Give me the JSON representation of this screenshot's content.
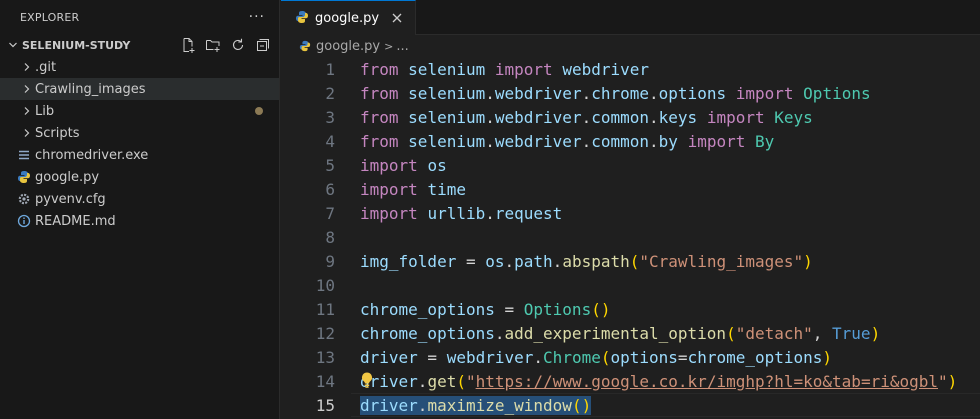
{
  "sidebar": {
    "title": "EXPLORER",
    "more": "···",
    "workspace": "SELENIUM-STUDY",
    "actions": [
      "new-file-icon",
      "new-folder-icon",
      "refresh-icon",
      "collapse-all-icon"
    ],
    "items": [
      {
        "label": ".git",
        "kind": "folder"
      },
      {
        "label": "Crawling_images",
        "kind": "folder"
      },
      {
        "label": "Lib",
        "kind": "folder",
        "modified": true
      },
      {
        "label": "Scripts",
        "kind": "folder"
      },
      {
        "label": "chromedriver.exe",
        "kind": "file",
        "icon": "exe-icon"
      },
      {
        "label": "google.py",
        "kind": "file",
        "icon": "python-icon"
      },
      {
        "label": "pyvenv.cfg",
        "kind": "file",
        "icon": "settings-icon"
      },
      {
        "label": "README.md",
        "kind": "file",
        "icon": "info-icon"
      }
    ]
  },
  "editor": {
    "tab_label": "google.py",
    "breadcrumb": {
      "file": "google.py",
      "sep": ">",
      "rest": "..."
    },
    "current_line": 15,
    "colors": {
      "keyword": "#c586c0",
      "function": "#dcdcaa",
      "variable": "#9cdcfe",
      "class": "#4ec9b0",
      "string": "#ce9178",
      "constant": "#569cd6",
      "selection": "#264f78"
    },
    "lines": [
      {
        "n": "1",
        "t": [
          [
            "kw",
            "from"
          ],
          [
            "op",
            " "
          ],
          [
            "var",
            "selenium"
          ],
          [
            "op",
            " "
          ],
          [
            "kw",
            "import"
          ],
          [
            "op",
            " "
          ],
          [
            "var",
            "webdriver"
          ]
        ]
      },
      {
        "n": "2",
        "t": [
          [
            "kw",
            "from"
          ],
          [
            "op",
            " "
          ],
          [
            "var",
            "selenium"
          ],
          [
            "op",
            "."
          ],
          [
            "var",
            "webdriver"
          ],
          [
            "op",
            "."
          ],
          [
            "var",
            "chrome"
          ],
          [
            "op",
            "."
          ],
          [
            "var",
            "options"
          ],
          [
            "op",
            " "
          ],
          [
            "kw",
            "import"
          ],
          [
            "op",
            " "
          ],
          [
            "cls",
            "Options"
          ]
        ]
      },
      {
        "n": "3",
        "t": [
          [
            "kw",
            "from"
          ],
          [
            "op",
            " "
          ],
          [
            "var",
            "selenium"
          ],
          [
            "op",
            "."
          ],
          [
            "var",
            "webdriver"
          ],
          [
            "op",
            "."
          ],
          [
            "var",
            "common"
          ],
          [
            "op",
            "."
          ],
          [
            "var",
            "keys"
          ],
          [
            "op",
            " "
          ],
          [
            "kw",
            "import"
          ],
          [
            "op",
            " "
          ],
          [
            "cls",
            "Keys"
          ]
        ]
      },
      {
        "n": "4",
        "t": [
          [
            "kw",
            "from"
          ],
          [
            "op",
            " "
          ],
          [
            "var",
            "selenium"
          ],
          [
            "op",
            "."
          ],
          [
            "var",
            "webdriver"
          ],
          [
            "op",
            "."
          ],
          [
            "var",
            "common"
          ],
          [
            "op",
            "."
          ],
          [
            "var",
            "by"
          ],
          [
            "op",
            " "
          ],
          [
            "kw",
            "import"
          ],
          [
            "op",
            " "
          ],
          [
            "cls",
            "By"
          ]
        ]
      },
      {
        "n": "5",
        "t": [
          [
            "kw",
            "import"
          ],
          [
            "op",
            " "
          ],
          [
            "var",
            "os"
          ]
        ]
      },
      {
        "n": "6",
        "t": [
          [
            "kw",
            "import"
          ],
          [
            "op",
            " "
          ],
          [
            "var",
            "time"
          ]
        ]
      },
      {
        "n": "7",
        "t": [
          [
            "kw",
            "import"
          ],
          [
            "op",
            " "
          ],
          [
            "var",
            "urllib"
          ],
          [
            "op",
            "."
          ],
          [
            "var",
            "request"
          ]
        ]
      },
      {
        "n": "8",
        "t": []
      },
      {
        "n": "9",
        "t": [
          [
            "var",
            "img_folder"
          ],
          [
            "op",
            " = "
          ],
          [
            "var",
            "os"
          ],
          [
            "op",
            "."
          ],
          [
            "var",
            "path"
          ],
          [
            "op",
            "."
          ],
          [
            "fn",
            "abspath"
          ],
          [
            "pn",
            "("
          ],
          [
            "str",
            "\"Crawling_images\""
          ],
          [
            "pn",
            ")"
          ]
        ]
      },
      {
        "n": "10",
        "t": []
      },
      {
        "n": "11",
        "t": [
          [
            "var",
            "chrome_options"
          ],
          [
            "op",
            " = "
          ],
          [
            "cls",
            "Options"
          ],
          [
            "pn",
            "()"
          ]
        ]
      },
      {
        "n": "12",
        "t": [
          [
            "var",
            "chrome_options"
          ],
          [
            "op",
            "."
          ],
          [
            "fn",
            "add_experimental_option"
          ],
          [
            "pn",
            "("
          ],
          [
            "str",
            "\"detach\""
          ],
          [
            "op",
            ", "
          ],
          [
            "cst",
            "True"
          ],
          [
            "pn",
            ")"
          ]
        ]
      },
      {
        "n": "13",
        "t": [
          [
            "var",
            "driver"
          ],
          [
            "op",
            " = "
          ],
          [
            "var",
            "webdriver"
          ],
          [
            "op",
            "."
          ],
          [
            "cls",
            "Chrome"
          ],
          [
            "pn",
            "("
          ],
          [
            "var",
            "options"
          ],
          [
            "op",
            "="
          ],
          [
            "var",
            "chrome_options"
          ],
          [
            "pn",
            ")"
          ]
        ]
      },
      {
        "n": "14",
        "t": [
          [
            "var",
            "driver"
          ],
          [
            "op",
            "."
          ],
          [
            "fn",
            "get"
          ],
          [
            "pn",
            "("
          ],
          [
            "str",
            "\""
          ],
          [
            "str url",
            "https://www.google.co.kr/imghp?hl=ko&tab=ri&ogbl"
          ],
          [
            "str",
            "\""
          ],
          [
            "pn",
            ")"
          ]
        ]
      },
      {
        "n": "15",
        "t": [
          [
            "var sel",
            "driver"
          ],
          [
            "op sel",
            "."
          ],
          [
            "fn sel",
            "maximize_window"
          ],
          [
            "pn sel",
            "()"
          ]
        ]
      }
    ]
  }
}
